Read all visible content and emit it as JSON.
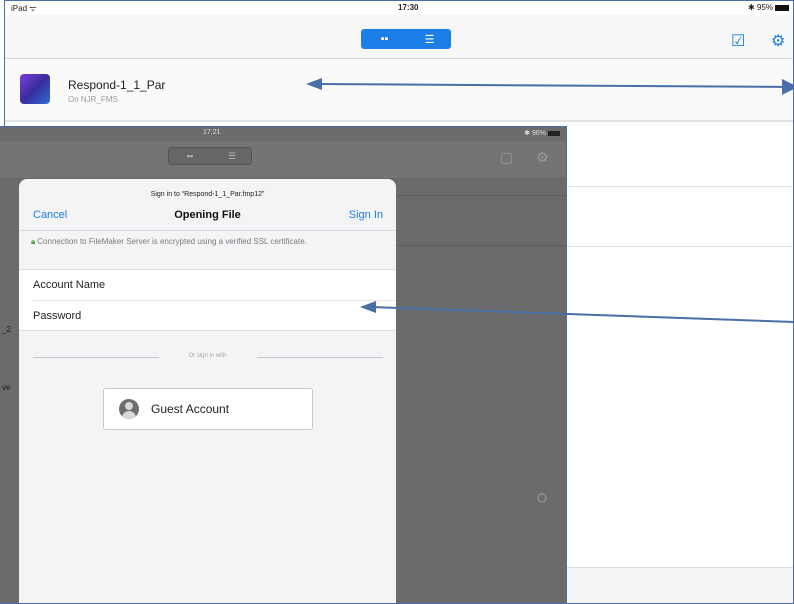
{
  "back_screen": {
    "status": {
      "device": "iPad",
      "time": "17:30",
      "battery": "95%"
    },
    "view_toggle": {
      "grid_icon": "grid-icon",
      "list_icon": "list-icon",
      "selected": "grid"
    },
    "toolbar_icons": [
      "document-check-icon",
      "gear-icon"
    ],
    "file_row": {
      "title": "Respond-1_1_Par",
      "subtitle": "On NJR_FMS",
      "icon": "filemaker-app-icon"
    }
  },
  "front_screen": {
    "status": {
      "time": "17:21",
      "battery": "96%"
    },
    "left_fragments": [
      "_2",
      "ve"
    ]
  },
  "signin_sheet": {
    "prompt": "Sign in to “Respond-1_1_Par.fmp12”",
    "cancel": "Cancel",
    "title": "Opening File",
    "sign_in": "Sign In",
    "ssl_message": "Connection to FileMaker Server is encrypted using a verified SSL certificate.",
    "account_placeholder": "Account Name",
    "password_placeholder": "Password",
    "or_sign_in_with": "Or sign in with",
    "guest_button": "Guest Account"
  },
  "colors": {
    "accent": "#1a7ee6",
    "arrow": "#4a6fa8",
    "dim": "#6b6b6b"
  }
}
